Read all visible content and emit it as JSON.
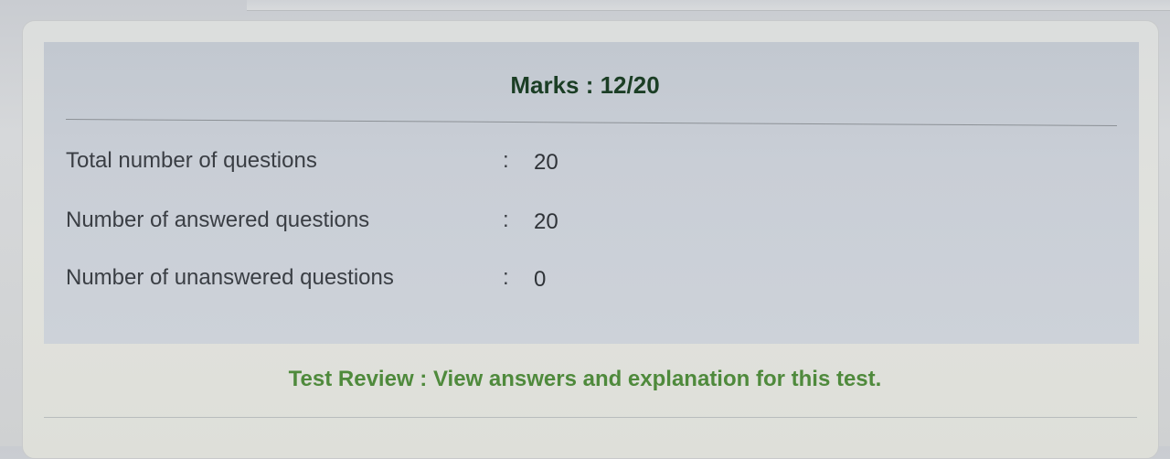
{
  "summary": {
    "marks_label": "Marks : 12/20",
    "rows": [
      {
        "label": "Total number of questions",
        "colon": ":",
        "value": "20"
      },
      {
        "label": "Number of answered questions",
        "colon": ":",
        "value": "20"
      },
      {
        "label": "Number of unanswered questions",
        "colon": ":",
        "value": "0"
      }
    ]
  },
  "review": {
    "link_text": "Test Review : View answers and explanation for this test."
  },
  "colors": {
    "title_text": "#1b3e25",
    "link_text": "#4f8a3c",
    "panel_bg": "#c9ced6"
  }
}
